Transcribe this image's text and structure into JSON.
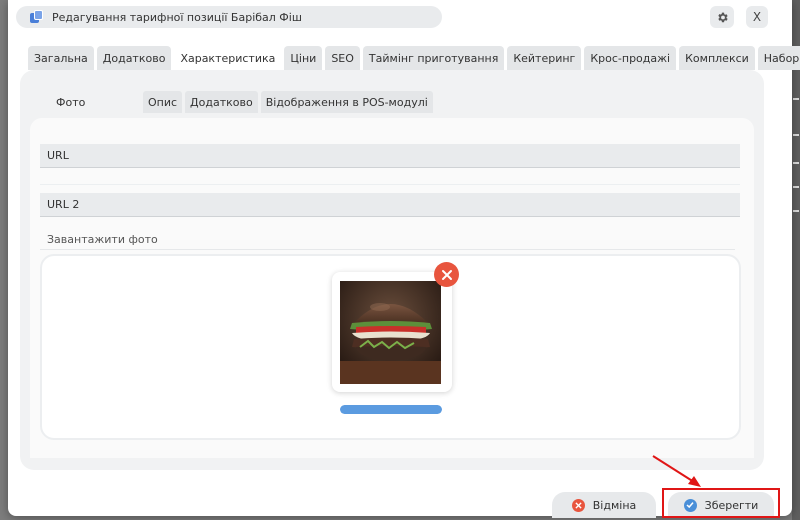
{
  "dialog": {
    "title": "Редагування тарифної позиції Барібал Фіш",
    "close_label": "X"
  },
  "main_tabs": [
    {
      "label": "Загальна"
    },
    {
      "label": "Додатково"
    },
    {
      "label": "Характеристика",
      "active": true
    },
    {
      "label": "Ціни"
    },
    {
      "label": "SEO"
    },
    {
      "label": "Таймінг приготування"
    },
    {
      "label": "Кейтеринг"
    },
    {
      "label": "Крос-продажі"
    },
    {
      "label": "Комплекси"
    },
    {
      "label": "Набори"
    }
  ],
  "sub_tabs": [
    {
      "label": "Фото",
      "active": true
    },
    {
      "label": "Опис"
    },
    {
      "label": "Додатково"
    },
    {
      "label": "Відображення в POS-модулі"
    }
  ],
  "fields": {
    "url_label": "URL",
    "url2_label": "URL 2"
  },
  "upload": {
    "label": "Завантажити фото",
    "progress": 1.0
  },
  "footer": {
    "cancel_label": "Відміна",
    "save_label": "Зберегти"
  },
  "colors": {
    "accent": "#4a7fd8",
    "danger": "#e8553e",
    "highlight": "#e01616",
    "progress": "#5b9be0"
  },
  "icons": {
    "title": "window-stack-icon",
    "settings": "gear-icon",
    "remove": "close-circle-icon",
    "cancel": "cancel-circle-icon",
    "save": "check-circle-icon"
  }
}
